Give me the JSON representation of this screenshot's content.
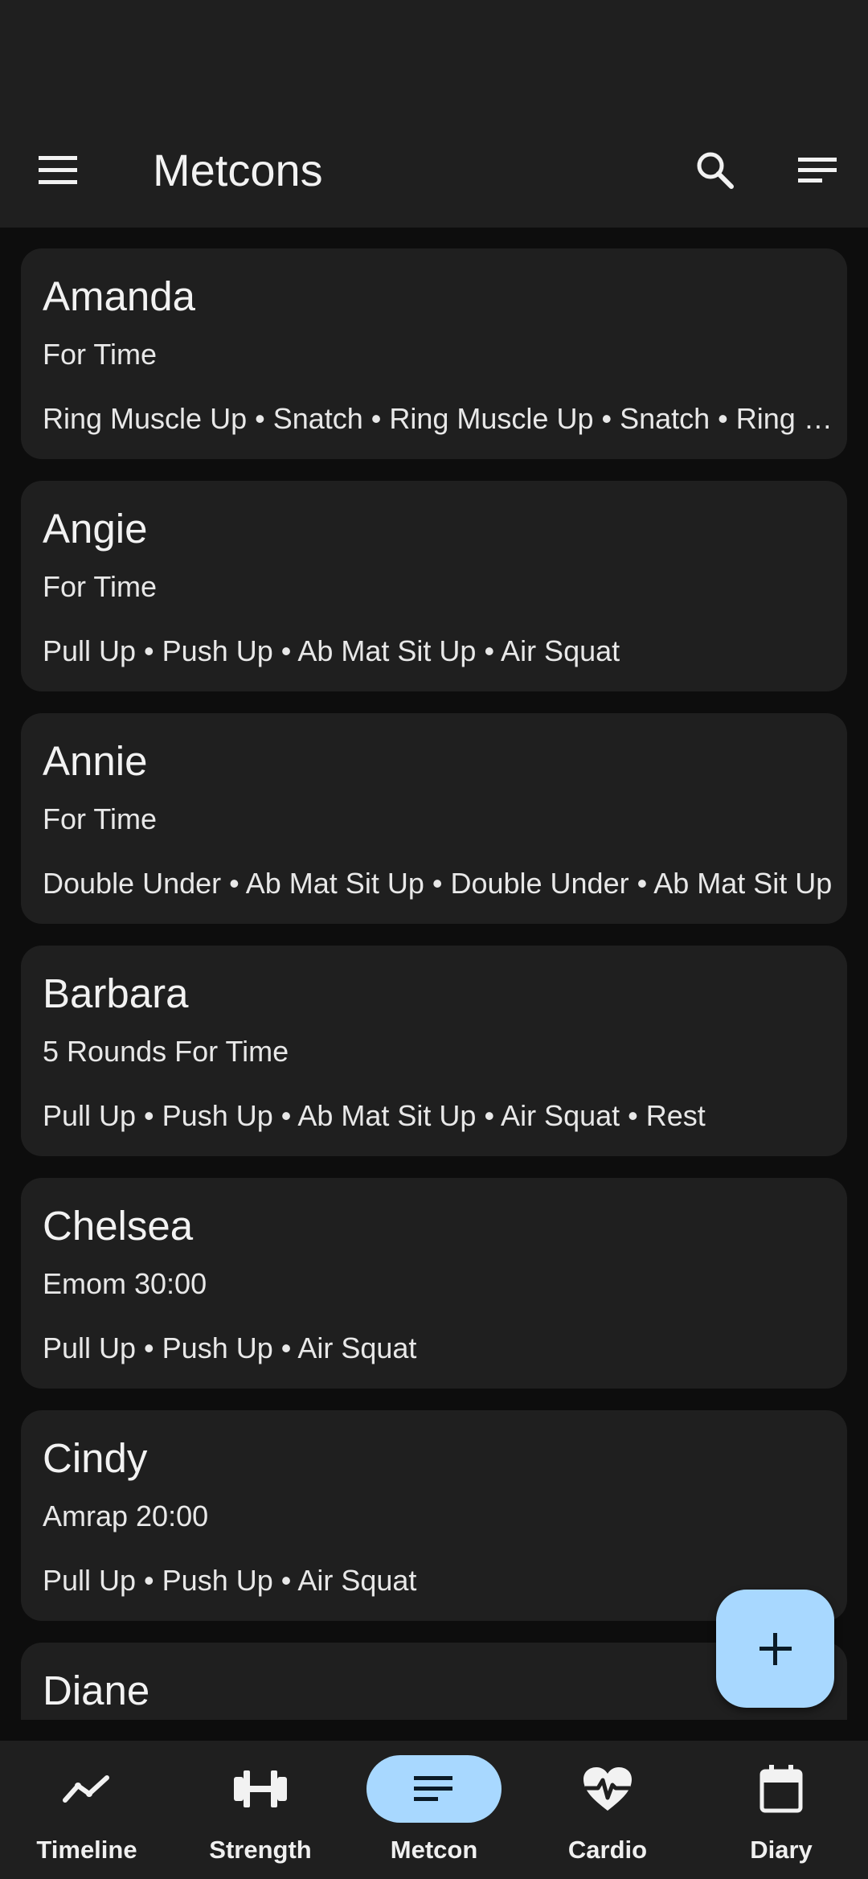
{
  "app_bar": {
    "title": "Metcons",
    "menu_icon": "menu-icon",
    "search_icon": "search-icon",
    "sort_icon": "sort-icon"
  },
  "metcons": [
    {
      "name": "Amanda",
      "type": "For Time",
      "movements": "Ring Muscle Up • Snatch • Ring Muscle Up • Snatch • Ring Muscle Up • Snatch"
    },
    {
      "name": "Angie",
      "type": "For Time",
      "movements": "Pull Up • Push Up • Ab Mat Sit Up • Air Squat"
    },
    {
      "name": "Annie",
      "type": "For Time",
      "movements": "Double Under • Ab Mat Sit Up • Double Under • Ab Mat Sit Up"
    },
    {
      "name": "Barbara",
      "type": "5 Rounds For Time",
      "movements": "Pull Up • Push Up • Ab Mat Sit Up • Air Squat • Rest"
    },
    {
      "name": "Chelsea",
      "type": "Emom 30:00",
      "movements": "Pull Up • Push Up • Air Squat"
    },
    {
      "name": "Cindy",
      "type": "Amrap 20:00",
      "movements": "Pull Up • Push Up • Air Squat"
    },
    {
      "name": "Diane",
      "type": "",
      "movements": ""
    }
  ],
  "fab": {
    "icon": "plus-icon"
  },
  "bottom_nav": {
    "items": [
      {
        "label": "Timeline",
        "icon": "timeline-icon"
      },
      {
        "label": "Strength",
        "icon": "dumbbell-icon"
      },
      {
        "label": "Metcon",
        "icon": "list-icon",
        "active": true
      },
      {
        "label": "Cardio",
        "icon": "heart-pulse-icon"
      },
      {
        "label": "Diary",
        "icon": "calendar-icon"
      }
    ]
  },
  "colors": {
    "surface": "#1f1f1f",
    "background": "#0d0d0d",
    "accent": "#a8d8ff",
    "text": "#f2f2f2"
  }
}
